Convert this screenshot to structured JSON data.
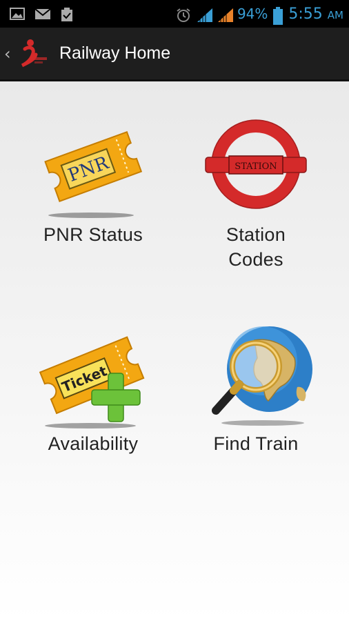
{
  "status_bar": {
    "icons_left": [
      "image-icon",
      "gmail-icon",
      "clipboard-check-icon"
    ],
    "icons_right": [
      "alarm-icon",
      "signal-icon",
      "signal-icon"
    ],
    "battery_percent": "94%",
    "time": "5:55",
    "ampm": "AM"
  },
  "action_bar": {
    "title": "Railway Home"
  },
  "tiles": [
    {
      "label": "PNR Status",
      "icon_text": "PNR",
      "icon": "pnr-ticket-icon"
    },
    {
      "label": "Station\nCodes",
      "icon_text": "STATION",
      "icon": "station-sign-icon"
    },
    {
      "label": "Availability",
      "icon_text": "Ticket",
      "icon": "ticket-plus-icon"
    },
    {
      "label": "Find Train",
      "icon": "globe-magnifier-icon"
    }
  ],
  "colors": {
    "accent": "#3a9fd6",
    "ticket_orange": "#f3a712",
    "station_red": "#d42a2a",
    "plus_green": "#6cc23a"
  }
}
